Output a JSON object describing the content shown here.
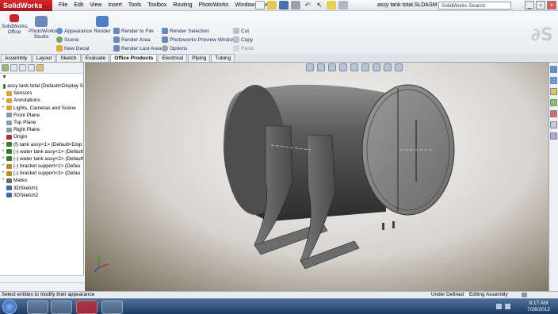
{
  "app": {
    "title": "SolidWorks",
    "document_title": "assy tank total.SLDASM"
  },
  "menu": [
    "File",
    "Edit",
    "View",
    "Insert",
    "Tools",
    "Toolbox",
    "Routing",
    "PhotoWorks",
    "Window",
    "Help"
  ],
  "search": {
    "placeholder": "SolidWorks Search"
  },
  "ribbon": {
    "solidworks_office": "SolidWorks\nOffice",
    "photoworks_studio": "PhotoWorks\nStudio",
    "appearance": "Appearance",
    "scene": "Scene",
    "new_decal": "New Decal",
    "render": "Render",
    "render_to_file": "Render to File",
    "render_area": "Render Area",
    "render_last_area": "Render Last Area",
    "render_selection": "Render Selection",
    "photoworks_preview_window": "Photoworks Preview Window",
    "options": "Options",
    "cut": "Cut",
    "copy": "Copy",
    "paste": "Paste"
  },
  "tabs": [
    "Assembly",
    "Layout",
    "Sketch",
    "Evaluate",
    "Office Products",
    "Electrical",
    "Piping",
    "Tubing"
  ],
  "active_tab": "Office Products",
  "tree": [
    {
      "label": "assy tank total  (Default<Display S",
      "toggle": "",
      "color": "#3a7b2a"
    },
    {
      "label": "Sensors",
      "toggle": "",
      "color": "#d8a238"
    },
    {
      "label": "Annotations",
      "toggle": "+",
      "color": "#d8a238"
    },
    {
      "label": "Lights, Cameras and Scene",
      "toggle": "+",
      "color": "#d8a238"
    },
    {
      "label": "Front Plane",
      "toggle": "",
      "color": "#8899aa"
    },
    {
      "label": "Top Plane",
      "toggle": "",
      "color": "#8899aa"
    },
    {
      "label": "Right Plane",
      "toggle": "",
      "color": "#8899aa"
    },
    {
      "label": "Origin",
      "toggle": "",
      "color": "#aa3333"
    },
    {
      "label": "(f) tank assy<1> (Default<Disp",
      "toggle": "+",
      "color": "#3a7b2a"
    },
    {
      "label": "(-) water tank assy<1> (Default",
      "toggle": "+",
      "color": "#3a7b2a"
    },
    {
      "label": "(-) water tank assy<2> (Default",
      "toggle": "+",
      "color": "#3a7b2a"
    },
    {
      "label": "(-) bracket support<1> (Defau",
      "toggle": "+",
      "color": "#b88a2a"
    },
    {
      "label": "(-) bracket support<3> (Defau",
      "toggle": "+",
      "color": "#b88a2a"
    },
    {
      "label": "Mates",
      "toggle": "+",
      "color": "#6a6a6a"
    },
    {
      "label": "3DSketch1",
      "toggle": "",
      "color": "#4466aa"
    },
    {
      "label": "3DSketch2",
      "toggle": "",
      "color": "#4466aa"
    }
  ],
  "status": {
    "message": "Select entities to modify their appearance",
    "state": "Under Defined",
    "mode": "Editing Assembly"
  },
  "clock": {
    "time": "8:17 AM",
    "date": "7/26/2012"
  },
  "colors": {
    "accent": "#c8262c",
    "taskbar": "#2a4a74"
  }
}
